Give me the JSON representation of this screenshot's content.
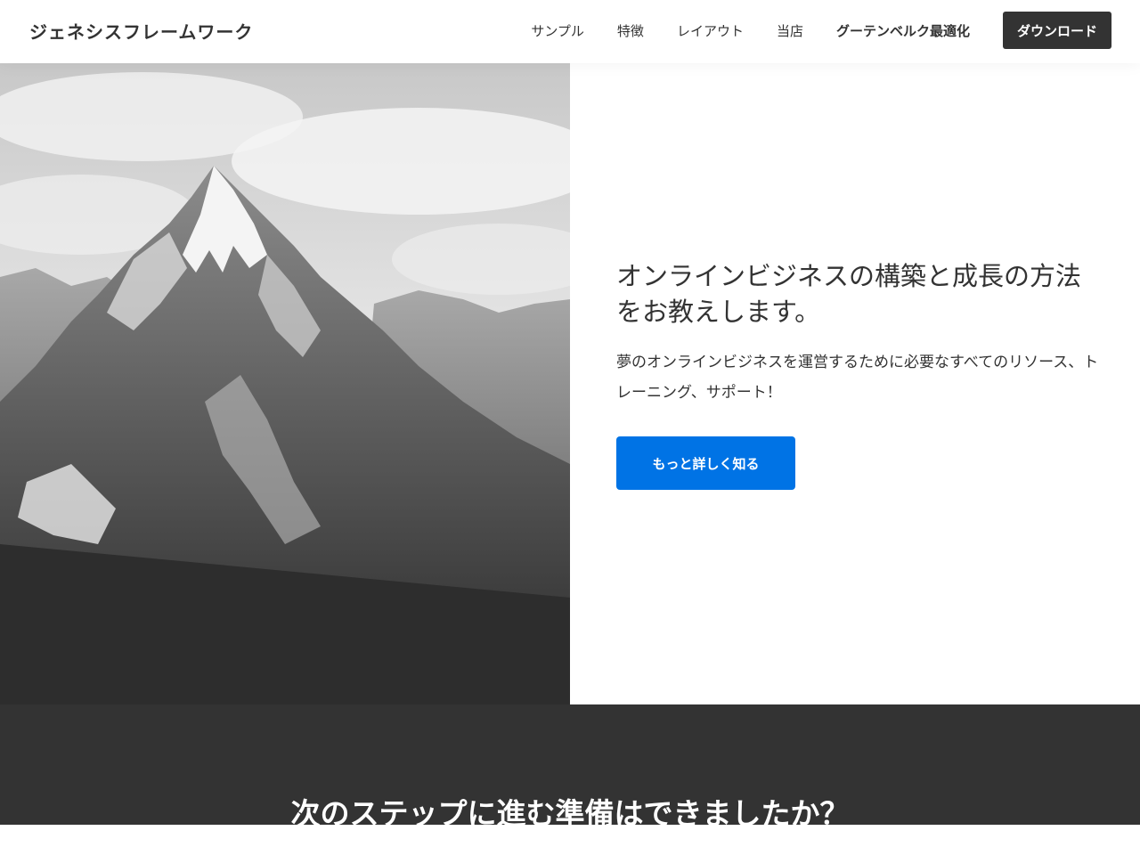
{
  "header": {
    "site_title": "ジェネシスフレームワーク",
    "nav": [
      {
        "label": "サンプル",
        "bold": false
      },
      {
        "label": "特徴",
        "bold": false
      },
      {
        "label": "レイアウト",
        "bold": false
      },
      {
        "label": "当店",
        "bold": false
      },
      {
        "label": "グーテンベルク最適化",
        "bold": true
      }
    ],
    "download_label": "ダウンロード"
  },
  "hero": {
    "title": "オンラインビジネスの構築と成長の方法をお教えします。",
    "text": "夢のオンラインビジネスを運営するために必要なすべてのリソース、トレーニング、サポート！",
    "button_label": "もっと詳しく知る"
  },
  "cta": {
    "heading": "次のステップに進む準備はできましたか？"
  },
  "colors": {
    "accent": "#0073e5",
    "dark": "#333333"
  }
}
